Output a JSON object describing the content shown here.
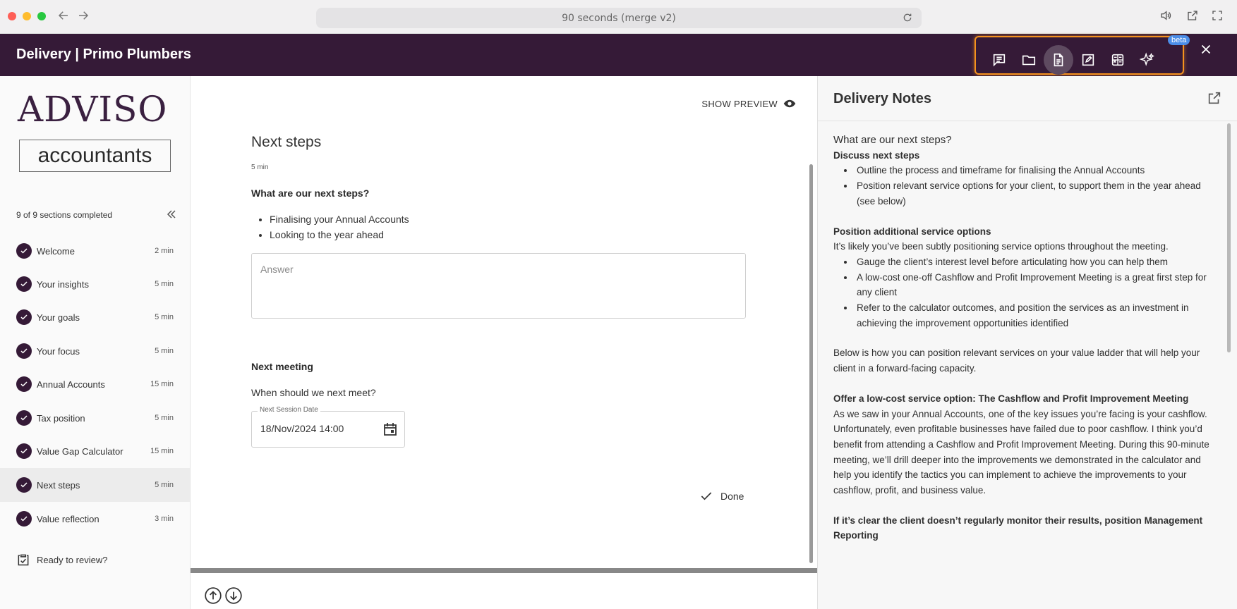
{
  "browser": {
    "url_text": "90 seconds (merge v2)",
    "traffic_lights": [
      "#fe5f57",
      "#febc2e",
      "#28c840"
    ]
  },
  "header": {
    "title": "Delivery | Primo Plumbers",
    "background": "#351a37",
    "highlight_color": "#f5921e",
    "toolbar_icons": [
      "notes-icon",
      "folder-icon",
      "document-icon",
      "edit-icon",
      "calculator-icon",
      "ai-sparkle-icon"
    ],
    "active_tool": "document-icon",
    "beta_label": "beta"
  },
  "sidebar": {
    "logo_top": "ADVISO",
    "logo_bottom": "accountants",
    "progress": "9 of 9 sections completed",
    "sections": [
      {
        "label": "Welcome",
        "time": "2 min"
      },
      {
        "label": "Your insights",
        "time": "5 min"
      },
      {
        "label": "Your goals",
        "time": "5 min"
      },
      {
        "label": "Your focus",
        "time": "5 min"
      },
      {
        "label": "Annual Accounts",
        "time": "15 min"
      },
      {
        "label": "Tax position",
        "time": "5 min"
      },
      {
        "label": "Value Gap Calculator",
        "time": "15 min"
      },
      {
        "label": "Next steps",
        "time": "5 min"
      },
      {
        "label": "Value reflection",
        "time": "3 min"
      }
    ],
    "active_section": "Next steps",
    "review_label": "Ready to review?"
  },
  "main": {
    "show_preview": "SHOW PREVIEW",
    "heading": "Next steps",
    "duration": "5 min",
    "question": "What are our next steps?",
    "bullets": [
      "Finalising your Annual Accounts",
      "Looking to the year ahead"
    ],
    "answer_placeholder": "Answer",
    "next_meeting_title": "Next meeting",
    "next_meeting_question": "When should we next meet?",
    "date_label": "Next Session Date",
    "date_value": "18/Nov/2024 14:00",
    "done_label": "Done"
  },
  "notes": {
    "title": "Delivery Notes",
    "question": "What are our next steps?",
    "discuss_title": "Discuss next steps",
    "discuss_items": [
      "Outline the process and timeframe for finalising the Annual Accounts",
      "Position relevant service options for your client, to support them in the year ahead (see below)"
    ],
    "position_title": "Position additional service options",
    "position_intro": "It’s likely you’ve been subtly positioning service options throughout the meeting.",
    "position_items": [
      "Gauge the client’s interest level before articulating how you can help them",
      "A low-cost one-off Cashflow and Profit Improvement Meeting is a great first step for any client",
      "Refer to the calculator outcomes, and position the services as an investment in achieving the improvement opportunities identified"
    ],
    "ladder_text": "Below is how you can position relevant services on your value ladder that will help your client in a forward-facing capacity.",
    "offer_title": "Offer a low-cost service option: The Cashflow and Profit Improvement Meeting",
    "offer_text": "As we saw in your Annual Accounts, one of the key issues you’re facing is your cashflow. Unfortunately, even profitable businesses have failed due to poor cashflow. I think you’d benefit from attending a Cashflow and Profit Improvement Meeting. During this 90-minute meeting, we’ll drill deeper into the improvements we demonstrated in the calculator and help you identify the tactics you can implement to achieve the improvements to your cashflow, profit, and business value.",
    "reporting_title": "If it’s clear the client doesn’t regularly monitor their results, position Management Reporting"
  }
}
